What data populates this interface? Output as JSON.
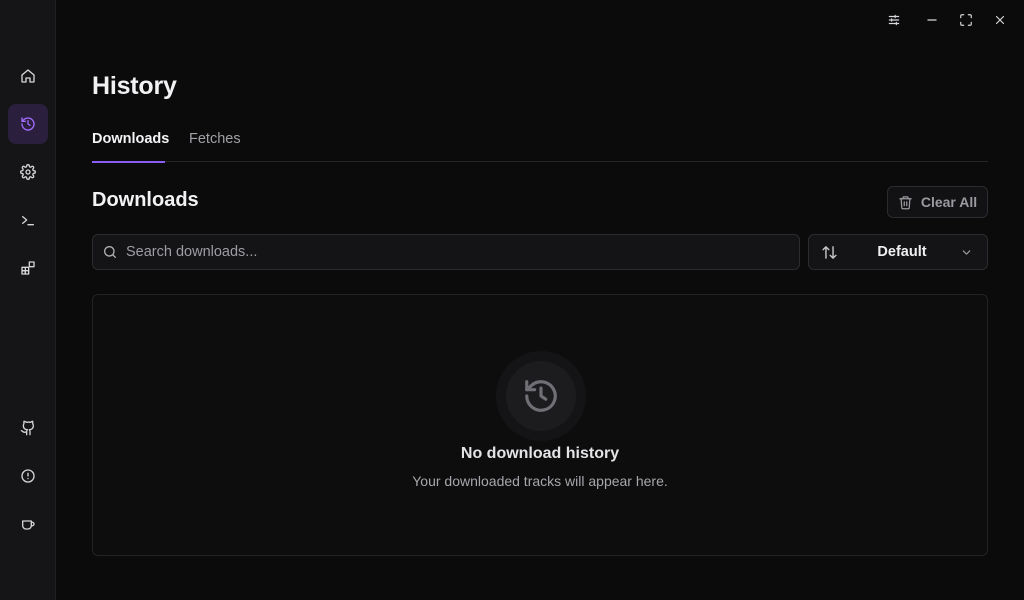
{
  "window": {
    "controls": [
      "settings-sliders-icon",
      "minimize-icon",
      "maximize-icon",
      "close-icon"
    ]
  },
  "sidebar": {
    "items": [
      {
        "name": "home",
        "icon": "home-icon",
        "active": false
      },
      {
        "name": "history",
        "icon": "history-icon",
        "active": true
      },
      {
        "name": "settings",
        "icon": "gear-icon",
        "active": false
      },
      {
        "name": "terminal",
        "icon": "terminal-icon",
        "active": false
      },
      {
        "name": "extensions",
        "icon": "blocks-icon",
        "active": false
      },
      {
        "name": "github",
        "icon": "github-icon",
        "active": false
      },
      {
        "name": "about",
        "icon": "info-icon",
        "active": false
      },
      {
        "name": "support",
        "icon": "coffee-icon",
        "active": false
      }
    ],
    "accent": "#a46bff"
  },
  "page": {
    "title": "History",
    "tabs": [
      {
        "label": "Downloads",
        "active": true
      },
      {
        "label": "Fetches",
        "active": false
      }
    ]
  },
  "downloads": {
    "section_title": "Downloads",
    "clear_all_label": "Clear All",
    "search_placeholder": "Search downloads...",
    "sort_label": "Default",
    "empty_title": "No download history",
    "empty_subtitle": "Your downloaded tracks will appear here."
  },
  "colors": {
    "accent": "#8b5cf6",
    "background": "#0b0b0c",
    "sidebar": "#151517"
  }
}
